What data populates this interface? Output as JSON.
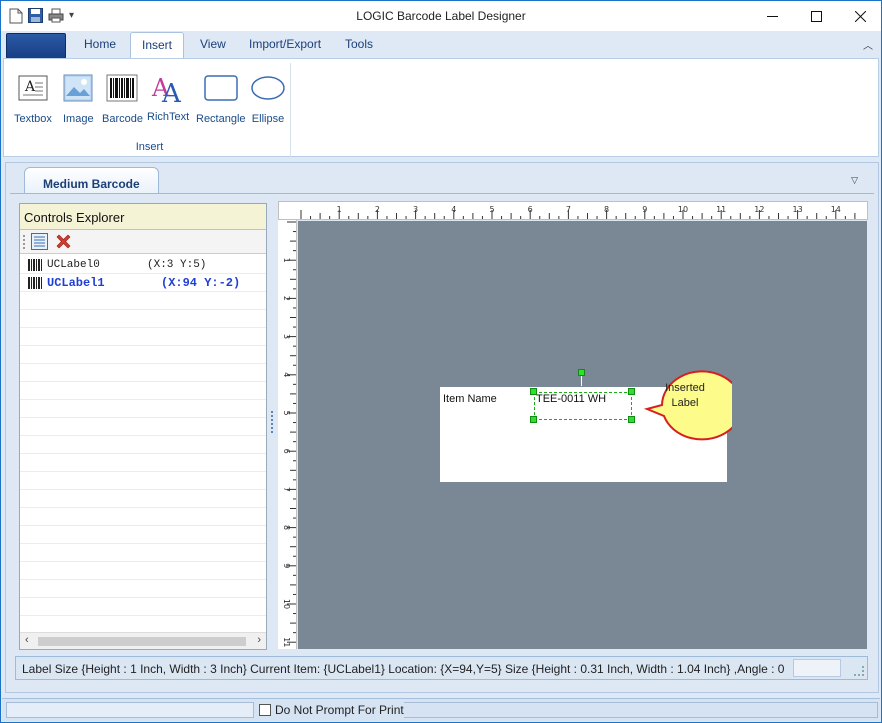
{
  "app": {
    "title": "LOGIC Barcode Label Designer"
  },
  "ribbon": {
    "tabs": [
      "Home",
      "Insert",
      "View",
      "Import/Export",
      "Tools"
    ],
    "active_tab": "Insert",
    "group": {
      "label": "Insert",
      "buttons": [
        {
          "label": "Textbox",
          "icon": "textbox-icon"
        },
        {
          "label": "Image",
          "icon": "image-icon"
        },
        {
          "label": "Barcode",
          "icon": "barcode-icon"
        },
        {
          "label": "RichText",
          "icon": "richtext-icon"
        },
        {
          "label": "Rectangle",
          "icon": "rectangle-icon"
        },
        {
          "label": "Ellipse",
          "icon": "ellipse-icon"
        }
      ]
    }
  },
  "document": {
    "tab_label": "Medium Barcode"
  },
  "explorer": {
    "title": "Controls Explorer",
    "items": [
      {
        "name": "UCLabel0",
        "pos": "(X:3 Y:5)"
      },
      {
        "name": "UCLabel1",
        "pos": "(X:94 Y:-2)"
      }
    ],
    "selected_index": 1
  },
  "ruler": {
    "h_labels": [
      "1",
      "2",
      "3",
      "4",
      "5",
      "6",
      "7",
      "8",
      "9",
      "10",
      "11",
      "12",
      "13",
      "14"
    ],
    "v_labels": [
      "1",
      "2",
      "3",
      "4",
      "5",
      "6",
      "7",
      "8",
      "9",
      "10",
      "11"
    ]
  },
  "label": {
    "item_name": "Item Name",
    "selected_value": "TEE-0011 WH",
    "callout_text": "Inserted Label"
  },
  "status": {
    "text": "Label Size {Height : 1 Inch, Width : 3 Inch}  Current Item: {UCLabel1} Location: {X=94,Y=5} Size {Height : 0.31 Inch, Width : 1.04 Inch} ,Angle : 0"
  },
  "bottom": {
    "checkbox_label": "Do Not Prompt For Print",
    "checked": false
  },
  "colors": {
    "accent": "#1a73c7",
    "canvas": "#7a8896",
    "selection": "#16b013",
    "callout_fill": "#fdfb8a",
    "callout_border": "#d42020",
    "selected_item_text": "#1f3fd4"
  }
}
